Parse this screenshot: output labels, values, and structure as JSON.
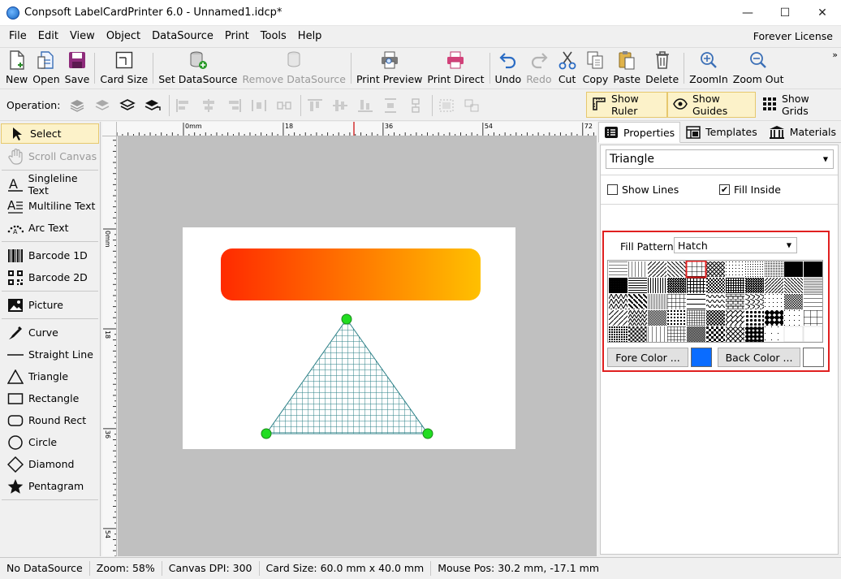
{
  "window": {
    "title": "Conpsoft LabelCardPrinter 6.0 - Unnamed1.idcp*",
    "minimize": "—",
    "maximize": "☐",
    "close": "✕"
  },
  "menu": {
    "items": [
      "File",
      "Edit",
      "View",
      "Object",
      "DataSource",
      "Print",
      "Tools",
      "Help"
    ],
    "license": "Forever License"
  },
  "toolbar": {
    "new": "New",
    "open": "Open",
    "save": "Save",
    "card_size": "Card Size",
    "set_datasource": "Set DataSource",
    "remove_datasource": "Remove DataSource",
    "print_preview": "Print Preview",
    "print_direct": "Print Direct",
    "undo": "Undo",
    "redo": "Redo",
    "cut": "Cut",
    "copy": "Copy",
    "paste": "Paste",
    "delete": "Delete",
    "zoom_in": "ZoomIn",
    "zoom_out": "Zoom Out",
    "more": "»"
  },
  "operation": {
    "label": "Operation:",
    "show_ruler": "Show Ruler",
    "show_guides": "Show Guides",
    "show_grids": "Show Grids",
    "show_ruler_on": true,
    "show_guides_on": true,
    "show_grids_on": false
  },
  "tools": {
    "select": "Select",
    "scroll_canvas": "Scroll Canvas",
    "singleline_text": "Singleline Text",
    "multiline_text": "Multiline Text",
    "arc_text": "Arc Text",
    "barcode_1d": "Barcode 1D",
    "barcode_2d": "Barcode 2D",
    "picture": "Picture",
    "curve": "Curve",
    "straight_line": "Straight Line",
    "triangle": "Triangle",
    "rectangle": "Rectangle",
    "round_rect": "Round Rect",
    "circle": "Circle",
    "diamond": "Diamond",
    "pentagram": "Pentagram"
  },
  "ruler": {
    "top_labels": [
      "0mm",
      "18",
      "36",
      "54",
      "72"
    ],
    "left_labels": [
      "0mm",
      "18",
      "36",
      "54"
    ]
  },
  "canvas": {
    "gradient_start": "#ff2a00",
    "gradient_end": "#ffc000",
    "hatch_color": "#2a7f86",
    "handle_color": "#22dd22"
  },
  "panel": {
    "tabs": {
      "properties": "Properties",
      "templates": "Templates",
      "materials": "Materials"
    },
    "object_type": "Triangle",
    "show_lines": "Show Lines",
    "show_lines_checked": false,
    "fill_inside": "Fill Inside",
    "fill_inside_checked": true,
    "fill_pattern_label": "Fill Pattern:",
    "fill_pattern_value": "Hatch",
    "fore_color_label": "Fore Color ...",
    "back_color_label": "Back Color ...",
    "fore_color": "#0a6cff",
    "back_color": "#ffffff",
    "check_mark": "✔"
  },
  "status": {
    "datasource": "No DataSource",
    "zoom": "Zoom: 58%",
    "dpi": "Canvas DPI: 300",
    "card_size": "Card Size: 60.0 mm x 40.0 mm",
    "mouse_pos": "Mouse Pos: 30.2 mm, -17.1 mm"
  }
}
